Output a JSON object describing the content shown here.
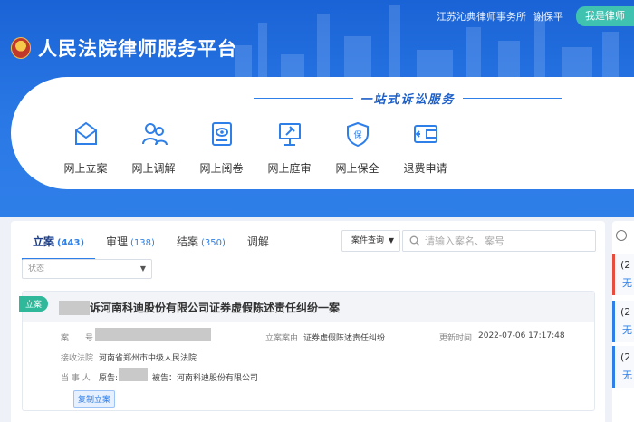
{
  "header": {
    "firm_name": "江苏沁典律师事务所",
    "user_name": "谢保平",
    "lawyer_button": "我是律师",
    "platform_title": "人民法院律师服务平台",
    "slogan": "一站式诉讼服务"
  },
  "services": [
    {
      "label": "网上立案",
      "icon": "mail-icon"
    },
    {
      "label": "网上调解",
      "icon": "users-icon"
    },
    {
      "label": "网上阅卷",
      "icon": "file-view-icon"
    },
    {
      "label": "网上庭审",
      "icon": "gavel-icon"
    },
    {
      "label": "网上保全",
      "icon": "shield-icon"
    },
    {
      "label": "退费申请",
      "icon": "wallet-icon"
    }
  ],
  "tabs": [
    {
      "label": "立案",
      "count": "(443)"
    },
    {
      "label": "审理",
      "count": "(138)"
    },
    {
      "label": "结案",
      "count": "(350)"
    },
    {
      "label": "调解",
      "count": ""
    }
  ],
  "filters": {
    "query_select": "案件查询",
    "search_placeholder": "请输入案名、案号",
    "status_placeholder": "状态"
  },
  "case": {
    "tag": "立案",
    "title": "诉河南科迪股份有限公司证券虚假陈述责任纠纷一案",
    "case_no_label": "案　　号",
    "cause_label": "立案案由",
    "cause_value": "证券虚假陈述责任纠纷",
    "updated_label": "更新时间",
    "updated_value": "2022-07-06 17:17:48",
    "court_label": "接收法院",
    "court_value": "河南省郑州市中级人民法院",
    "parties_label": "当 事 人",
    "plaintiff_prefix": "原告:",
    "defendant": "被告：河南科迪股份有限公司",
    "copy_button": "复制立案"
  },
  "side": {
    "items": [
      {
        "top": "(2",
        "bottom": "无"
      },
      {
        "top": "(2",
        "bottom": "无"
      },
      {
        "top": "(2",
        "bottom": "无"
      }
    ]
  }
}
